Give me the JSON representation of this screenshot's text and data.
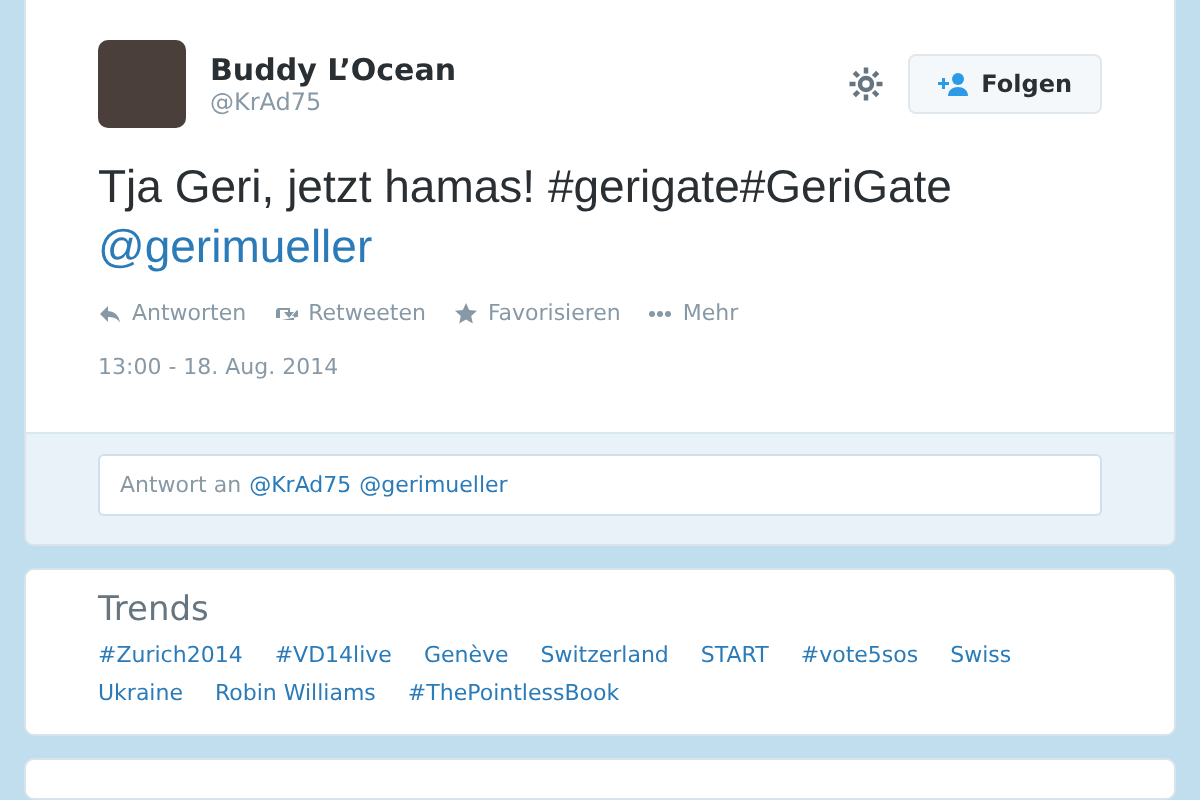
{
  "tweet": {
    "name": "Buddy L’Ocean",
    "handle": "@KrAd75",
    "follow_button": "Folgen",
    "text": [
      {
        "text": "Tja Geri, jetzt hamas! #gerigate#GeriGate",
        "kind": "plain"
      },
      {
        "text": "@gerimueller",
        "kind": "mention"
      }
    ],
    "actions": [
      {
        "label": "Antworten",
        "kind": "reply"
      },
      {
        "label": "Retweeten",
        "kind": "retweet"
      },
      {
        "label": "Favorisieren",
        "kind": "favorite"
      },
      {
        "label": "Mehr",
        "kind": "more"
      }
    ],
    "timestamp": "13:00 - 18. Aug. 2014"
  },
  "reply": {
    "prefix": "Antwort an",
    "mentions": [
      "@KrAd75",
      "@gerimueller"
    ]
  },
  "trends": {
    "title": "Trends",
    "items": [
      "#Zurich2014",
      "#VD14live",
      "Genève",
      "Switzerland",
      "START",
      "#vote5sos",
      "Swiss",
      "Ukraine",
      "Robin Williams",
      "#ThePointlessBook"
    ]
  }
}
